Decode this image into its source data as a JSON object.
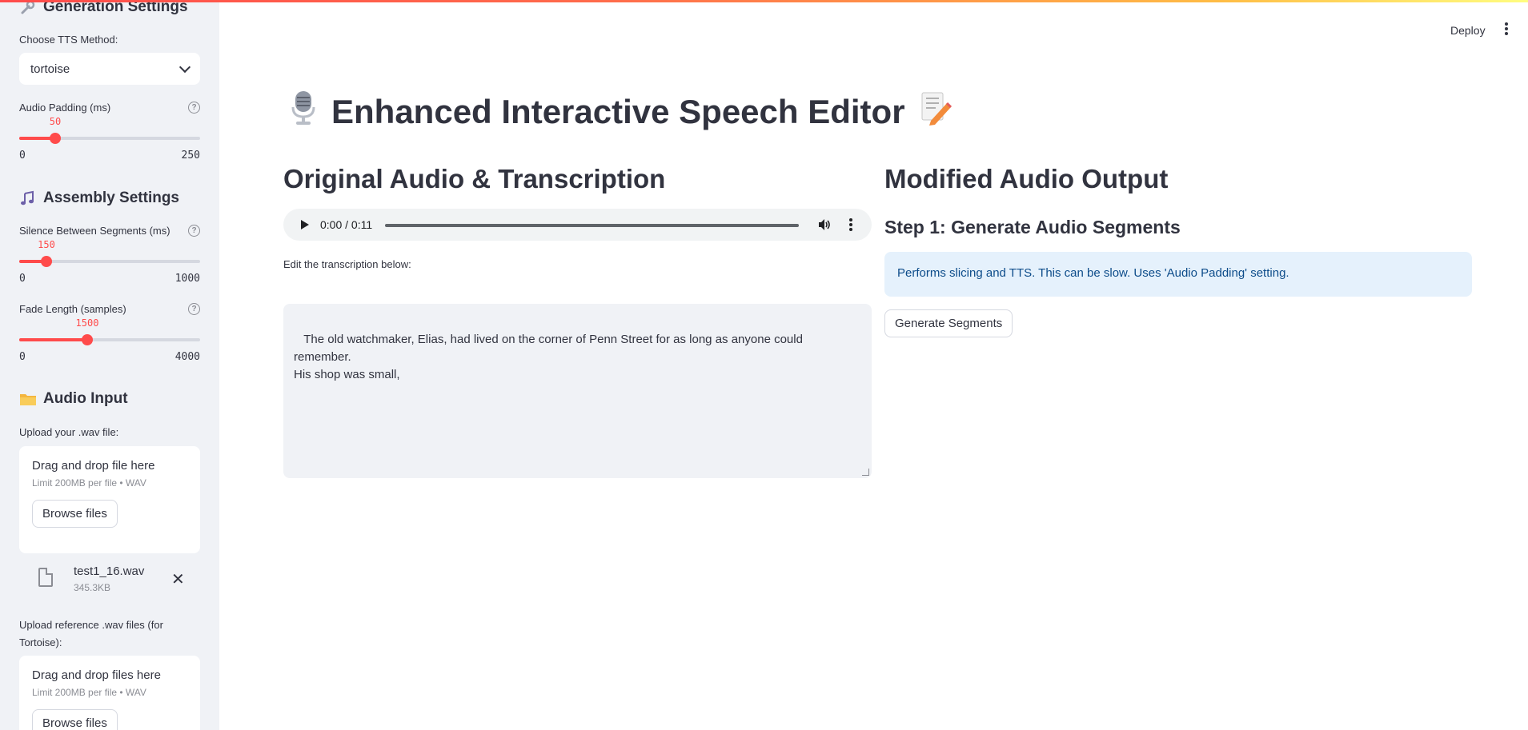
{
  "sidebar": {
    "generation": {
      "header": "Generation Settings",
      "tts_label": "Choose TTS Method:",
      "tts_value": "tortoise",
      "padding_label": "Audio Padding (ms)",
      "padding_value": "50",
      "padding_min": "0",
      "padding_max": "250",
      "padding_fraction": 0.2
    },
    "assembly": {
      "header": "Assembly Settings",
      "silence_label": "Silence Between Segments (ms)",
      "silence_value": "150",
      "silence_min": "0",
      "silence_max": "1000",
      "silence_fraction": 0.15,
      "fade_label": "Fade Length (samples)",
      "fade_value": "1500",
      "fade_min": "0",
      "fade_max": "4000",
      "fade_fraction": 0.375
    },
    "audio_input": {
      "header": "Audio Input",
      "upload_label": "Upload your .wav file:",
      "dz_title": "Drag and drop file here",
      "dz_sub": "Limit 200MB per file • WAV",
      "browse_label": "Browse files",
      "file_name": "test1_16.wav",
      "file_size": "345.3KB",
      "ref_label": "Upload reference .wav files (for Tortoise):",
      "ref_dz_title": "Drag and drop files here",
      "ref_dz_sub": "Limit 200MB per file • WAV",
      "ref_browse_label": "Browse files"
    }
  },
  "toolbar": {
    "deploy_label": "Deploy"
  },
  "main": {
    "title": "Enhanced Interactive Speech Editor",
    "left": {
      "header": "Original Audio & Transcription",
      "audio_time": "0:00 / 0:11",
      "edit_label": "Edit the transcription below:",
      "transcription": " The old watchmaker, Elias, had lived on the corner of Penn Street for as long as anyone could remember.\nHis shop was small,"
    },
    "right": {
      "header": "Modified Audio Output",
      "step1": "Step 1: Generate Audio Segments",
      "info": "Performs slicing and TTS. This can be slow. Uses 'Audio Padding' setting.",
      "generate_label": "Generate Segments"
    }
  },
  "colors": {
    "accent": "#ff4b4b",
    "sidebar_bg": "#f0f2f6",
    "info_bg": "#e5f1fc",
    "info_text": "#0d4c8a"
  }
}
